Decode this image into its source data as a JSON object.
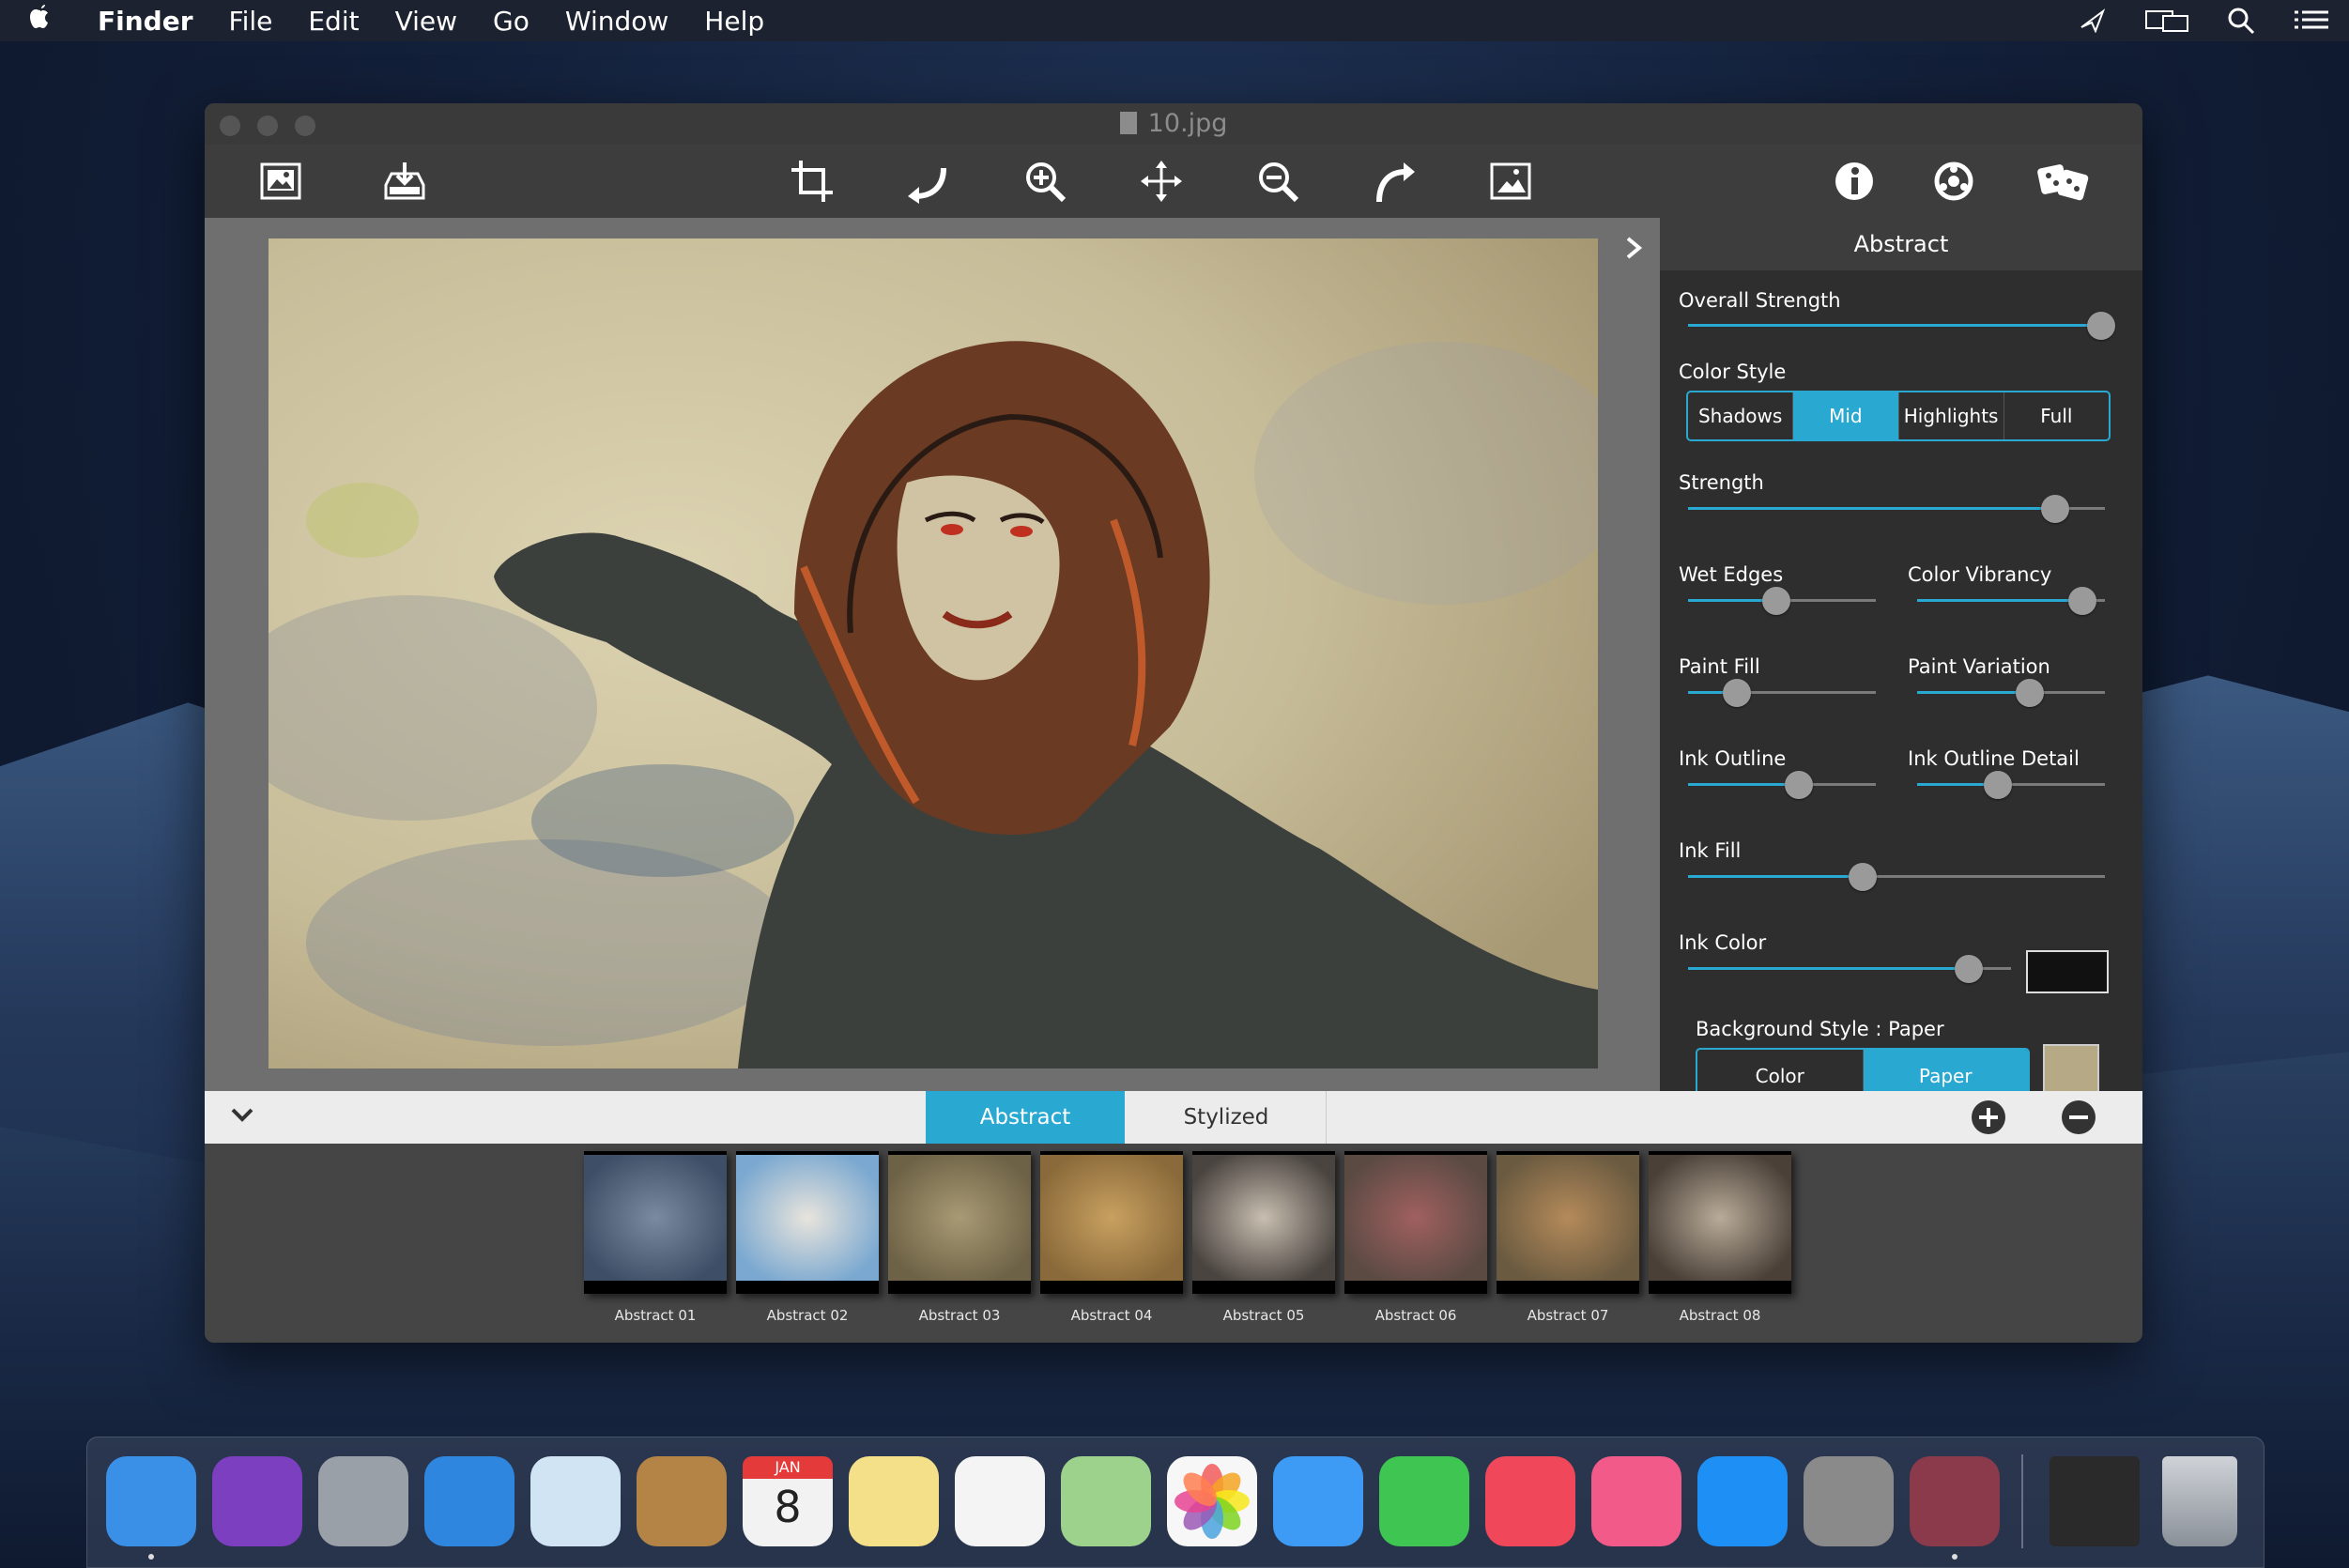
{
  "menubar": {
    "items": [
      "Finder",
      "File",
      "Edit",
      "View",
      "Go",
      "Window",
      "Help"
    ]
  },
  "window": {
    "title": "10.jpg",
    "toolbar": {
      "left": [
        "open-image",
        "save"
      ],
      "center": [
        "crop",
        "rotate-left",
        "zoom-in",
        "pan",
        "zoom-out",
        "rotate-right",
        "fit-image"
      ],
      "right": [
        "info",
        "settings",
        "random"
      ]
    }
  },
  "panel": {
    "title": "Abstract",
    "overall_strength": {
      "label": "Overall Strength",
      "value": 1.0
    },
    "color_style": {
      "label": "Color Style",
      "options": [
        "Shadows",
        "Mid",
        "Highlights",
        "Full"
      ],
      "selected": "Mid"
    },
    "strength": {
      "label": "Strength",
      "value": 0.88
    },
    "wet_edges": {
      "label": "Wet Edges",
      "value": 0.47
    },
    "color_vibrancy": {
      "label": "Color Vibrancy",
      "value": 0.88
    },
    "paint_fill": {
      "label": "Paint Fill",
      "value": 0.26
    },
    "paint_variation": {
      "label": "Paint Variation",
      "value": 0.6
    },
    "ink_outline": {
      "label": "Ink Outline",
      "value": 0.59
    },
    "ink_outline_detail": {
      "label": "Ink Outline Detail",
      "value": 0.43
    },
    "ink_fill": {
      "label": "Ink Fill",
      "value": 0.42
    },
    "ink_color": {
      "label": "Ink Color",
      "value": 0.87,
      "swatch": "#111111"
    },
    "background_style": {
      "label": "Background Style : Paper",
      "options": [
        "Color",
        "Paper"
      ],
      "selected": "Paper"
    }
  },
  "tabs": [
    "Abstract",
    "Stylized"
  ],
  "presets": [
    {
      "label": "Abstract 01",
      "colors": [
        "#3e4e66",
        "#7a8aa0"
      ]
    },
    {
      "label": "Abstract 02",
      "colors": [
        "#7aa8d0",
        "#e8e4dc"
      ]
    },
    {
      "label": "Abstract 03",
      "colors": [
        "#6e6246",
        "#a89a74"
      ]
    },
    {
      "label": "Abstract 04",
      "colors": [
        "#8a6a3a",
        "#c8a060"
      ]
    },
    {
      "label": "Abstract 05",
      "colors": [
        "#4a4440",
        "#c8beb0"
      ]
    },
    {
      "label": "Abstract 06",
      "colors": [
        "#5a4a42",
        "#a06060"
      ]
    },
    {
      "label": "Abstract 07",
      "colors": [
        "#6a5a40",
        "#b48a5a"
      ]
    },
    {
      "label": "Abstract 08",
      "colors": [
        "#4a4038",
        "#b8ab98"
      ]
    }
  ],
  "dock": [
    {
      "name": "finder",
      "color": "#3a8fe6"
    },
    {
      "name": "siri",
      "color": "#7b3fbf"
    },
    {
      "name": "launchpad",
      "color": "#9aa0a8"
    },
    {
      "name": "safari",
      "color": "#2e86de"
    },
    {
      "name": "mail",
      "color": "#d0e4f4"
    },
    {
      "name": "contacts",
      "color": "#b48446"
    },
    {
      "name": "calendar",
      "color": "#f2f2f2"
    },
    {
      "name": "notes",
      "color": "#f5e08a"
    },
    {
      "name": "reminders",
      "color": "#f4f4f4"
    },
    {
      "name": "maps",
      "color": "#9cd28c"
    },
    {
      "name": "photos",
      "color": "#f7f7f7"
    },
    {
      "name": "messages",
      "color": "#3d9bf5"
    },
    {
      "name": "facetime",
      "color": "#3fc552"
    },
    {
      "name": "news",
      "color": "#f0485a"
    },
    {
      "name": "music",
      "color": "#f25a8a"
    },
    {
      "name": "app-store",
      "color": "#1e90f5"
    },
    {
      "name": "system-preferences",
      "color": "#8a8a8a"
    },
    {
      "name": "jixipix-app",
      "color": "#8a3a4a"
    }
  ],
  "calendar_icon": {
    "month": "JAN",
    "day": "8"
  }
}
